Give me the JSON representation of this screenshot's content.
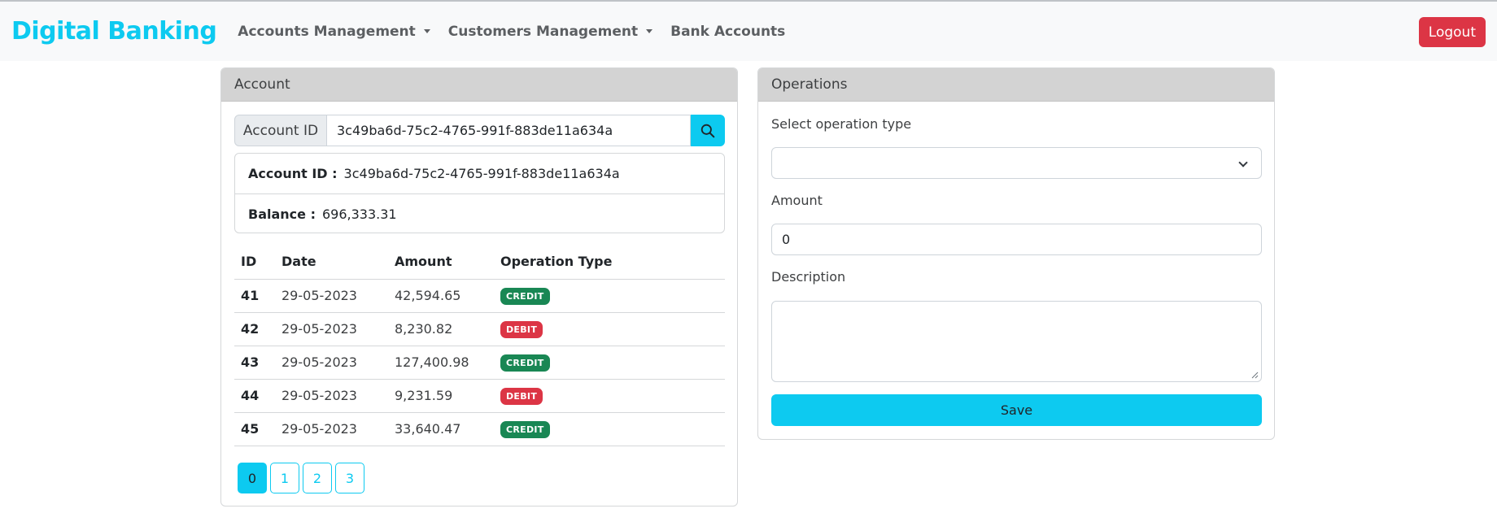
{
  "navbar": {
    "brand": "Digital Banking",
    "items": [
      {
        "label": "Accounts Management",
        "dropdown": true
      },
      {
        "label": "Customers Management",
        "dropdown": true
      },
      {
        "label": "Bank Accounts",
        "dropdown": false
      }
    ],
    "logout_label": "Logout"
  },
  "account": {
    "header": "Account",
    "search": {
      "label": "Account ID",
      "value": "3c49ba6d-75c2-4765-991f-883de11a634a",
      "icon": "search-icon"
    },
    "info": {
      "id_label": "Account ID :",
      "id_value": "3c49ba6d-75c2-4765-991f-883de11a634a",
      "balance_label": "Balance :",
      "balance_value": "696,333.31"
    },
    "table": {
      "headers": [
        "ID",
        "Date",
        "Amount",
        "Operation Type"
      ],
      "rows": [
        {
          "id": "41",
          "date": "29-05-2023",
          "amount": "42,594.65",
          "type": "CREDIT"
        },
        {
          "id": "42",
          "date": "29-05-2023",
          "amount": "8,230.82",
          "type": "DEBIT"
        },
        {
          "id": "43",
          "date": "29-05-2023",
          "amount": "127,400.98",
          "type": "CREDIT"
        },
        {
          "id": "44",
          "date": "29-05-2023",
          "amount": "9,231.59",
          "type": "DEBIT"
        },
        {
          "id": "45",
          "date": "29-05-2023",
          "amount": "33,640.47",
          "type": "CREDIT"
        }
      ]
    },
    "pagination": {
      "pages": [
        "0",
        "1",
        "2",
        "3"
      ],
      "active": "0"
    }
  },
  "operations": {
    "header": "Operations",
    "type_label": "Select operation type",
    "type_value": "",
    "amount_label": "Amount",
    "amount_value": "0",
    "description_label": "Description",
    "description_value": "",
    "save_label": "Save"
  },
  "colors": {
    "accent": "#0dcaf0",
    "danger": "#dc3545",
    "success": "#198754",
    "header_bg": "#d3d3d3"
  }
}
